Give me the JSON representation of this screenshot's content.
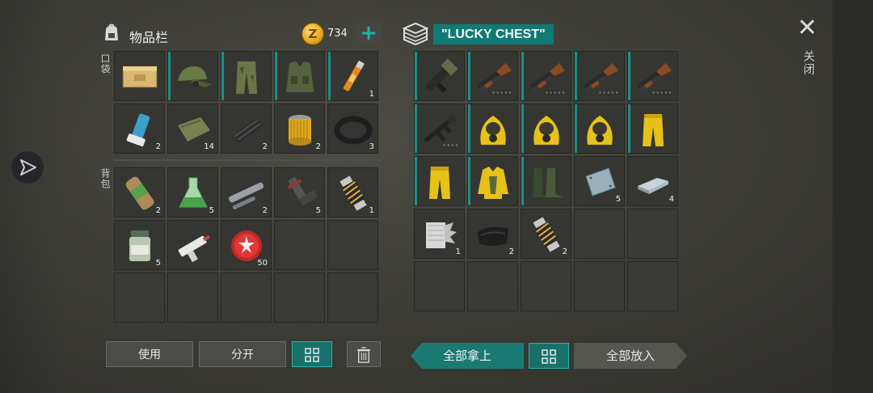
{
  "inventory": {
    "title": "物品栏",
    "coins": "734",
    "pockets_label": "口袋",
    "backpack_label": "背包",
    "pockets": [
      {
        "icon": "ammo-box-icon",
        "count": "",
        "accent": false
      },
      {
        "icon": "military-cap-icon",
        "count": "",
        "accent": true
      },
      {
        "icon": "camo-pants-icon",
        "count": "",
        "accent": true
      },
      {
        "icon": "tactical-vest-icon",
        "count": "",
        "accent": true
      },
      {
        "icon": "vial-icon",
        "count": "1",
        "accent": true
      },
      {
        "icon": "inhaler-icon",
        "count": "2",
        "accent": false
      },
      {
        "icon": "cloth-icon",
        "count": "14",
        "accent": false
      },
      {
        "icon": "fabric-roll-icon",
        "count": "2",
        "accent": false
      },
      {
        "icon": "oil-filter-icon",
        "count": "2",
        "accent": false
      },
      {
        "icon": "rubber-hose-icon",
        "count": "3",
        "accent": false
      }
    ],
    "backpack": [
      {
        "icon": "bandage-roll-icon",
        "count": "2"
      },
      {
        "icon": "flask-icon",
        "count": "5"
      },
      {
        "icon": "metal-pipe-icon",
        "count": "2"
      },
      {
        "icon": "pipe-fitting-icon",
        "count": "5"
      },
      {
        "icon": "spring-coil-icon",
        "count": "1"
      },
      {
        "icon": "pill-bottle-icon",
        "count": "5"
      },
      {
        "icon": "syringe-gun-icon",
        "count": ""
      },
      {
        "icon": "bottle-cap-icon",
        "count": "50"
      },
      {
        "icon": "",
        "count": ""
      },
      {
        "icon": "",
        "count": ""
      },
      {
        "icon": "",
        "count": ""
      },
      {
        "icon": "",
        "count": ""
      },
      {
        "icon": "",
        "count": ""
      },
      {
        "icon": "",
        "count": ""
      },
      {
        "icon": "",
        "count": ""
      }
    ],
    "use_label": "使用",
    "split_label": "分开"
  },
  "chest": {
    "name": "\"LUCKY CHEST\"",
    "items": [
      {
        "icon": "grenade-launcher-icon",
        "count": "",
        "dots": "",
        "accent": true
      },
      {
        "icon": "shotgun-icon",
        "count": "",
        "dots": "•••••",
        "accent": true
      },
      {
        "icon": "shotgun-icon",
        "count": "",
        "dots": "•••••",
        "accent": true
      },
      {
        "icon": "shotgun-icon",
        "count": "",
        "dots": "•••••",
        "accent": true
      },
      {
        "icon": "shotgun-icon",
        "count": "",
        "dots": "•••••",
        "accent": true
      },
      {
        "icon": "assault-rifle-icon",
        "count": "",
        "dots": "••••",
        "accent": true
      },
      {
        "icon": "hazmat-hood-icon",
        "count": "",
        "dots": "",
        "accent": true
      },
      {
        "icon": "hazmat-hood-icon",
        "count": "",
        "dots": "",
        "accent": true
      },
      {
        "icon": "hazmat-hood-icon",
        "count": "",
        "dots": "",
        "accent": true
      },
      {
        "icon": "hazmat-pants-icon",
        "count": "",
        "dots": "",
        "accent": true
      },
      {
        "icon": "hazmat-pants-icon",
        "count": "",
        "dots": "",
        "accent": true
      },
      {
        "icon": "hazmat-jacket-icon",
        "count": "",
        "dots": "",
        "accent": true
      },
      {
        "icon": "rubber-boots-icon",
        "count": "",
        "dots": "",
        "accent": true
      },
      {
        "icon": "metal-plate-icon",
        "count": "5",
        "dots": "",
        "accent": false
      },
      {
        "icon": "metal-ingot-icon",
        "count": "4",
        "dots": "",
        "accent": false
      },
      {
        "icon": "steel-wool-icon",
        "count": "1",
        "dots": "",
        "accent": false
      },
      {
        "icon": "leather-icon",
        "count": "2",
        "dots": "",
        "accent": false
      },
      {
        "icon": "spring-coil-icon",
        "count": "2",
        "dots": "",
        "accent": false
      },
      {
        "icon": "",
        "count": "",
        "dots": "",
        "accent": false
      },
      {
        "icon": "",
        "count": "",
        "dots": "",
        "accent": false
      },
      {
        "icon": "",
        "count": "",
        "dots": "",
        "accent": false
      },
      {
        "icon": "",
        "count": "",
        "dots": "",
        "accent": false
      },
      {
        "icon": "",
        "count": "",
        "dots": "",
        "accent": false
      },
      {
        "icon": "",
        "count": "",
        "dots": "",
        "accent": false
      },
      {
        "icon": "",
        "count": "",
        "dots": "",
        "accent": false
      }
    ],
    "take_all_label": "全部拿上",
    "put_all_label": "全部放入"
  },
  "close_label": "关闭",
  "colors": {
    "accent": "#1a8f86",
    "button_teal": "#197a73"
  }
}
